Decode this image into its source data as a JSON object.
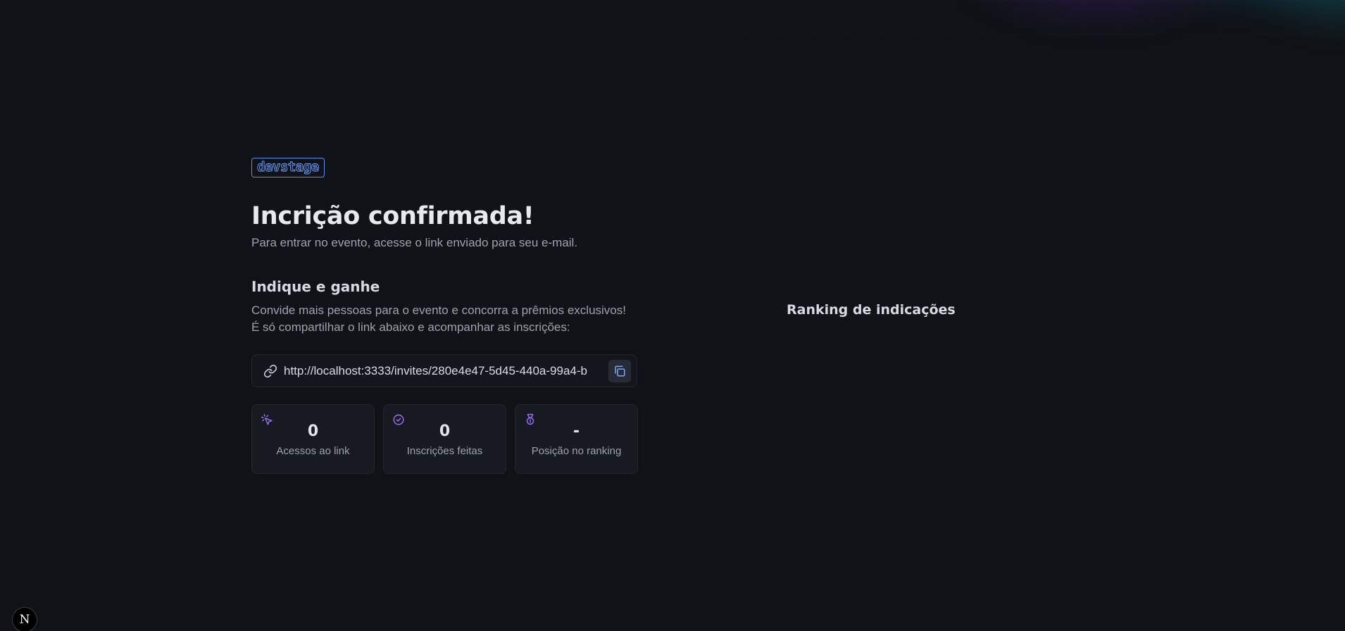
{
  "logo": {
    "text": "devstage"
  },
  "header": {
    "title": "Incrição confirmada!",
    "subtitle": "Para entrar no evento, acesse o link enviado para seu e-mail."
  },
  "invite": {
    "section_title": "Indique e ganhe",
    "description_line1": "Convide mais pessoas para o evento e concorra a prêmios exclusivos!",
    "description_line2": "É só compartilhar o link abaixo e acompanhar as inscrições:",
    "link": "http://localhost:3333/invites/280e4e47-5d45-440a-99a4-b",
    "copy_icon": "copy-icon",
    "link_icon": "link-icon"
  },
  "stats": [
    {
      "value": "0",
      "label": "Acessos ao link",
      "icon": "cursor-click-icon"
    },
    {
      "value": "0",
      "label": "Inscrições feitas",
      "icon": "badge-check-icon"
    },
    {
      "value": "-",
      "label": "Posição no ranking",
      "icon": "medal-icon"
    }
  ],
  "ranking": {
    "title": "Ranking de indicações"
  },
  "dev_badge": {
    "text": "N"
  },
  "colors": {
    "background": "#101217",
    "accent_blue": "#6f9cf0",
    "accent_purple": "#9b6cf6"
  }
}
